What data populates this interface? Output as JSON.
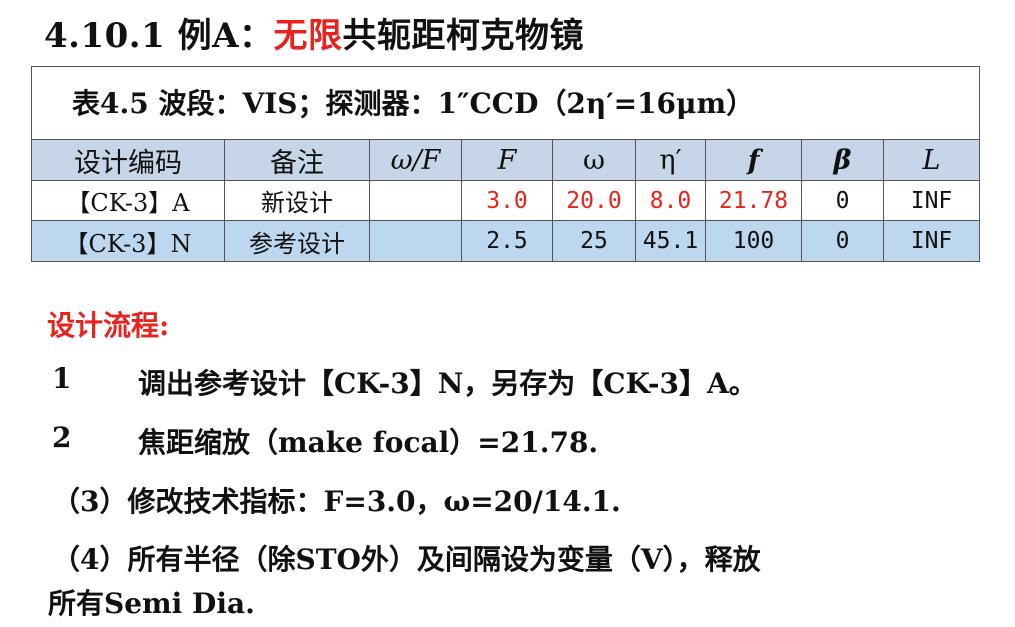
{
  "title": {
    "prefix": "4.10.1  例A：",
    "highlight": "无限",
    "suffix": "共轭距柯克物镜"
  },
  "table": {
    "caption": "表4.5    波段：VIS；探测器：1″CCD（2η′=16μm）",
    "headers": [
      "设计编码",
      "备注",
      "ω/F",
      "F",
      "ω",
      "η′",
      "f",
      "β",
      "L"
    ],
    "rows": [
      {
        "code": "【CK-3】A",
        "note": "新设计",
        "omega_f": "",
        "F": "3.0",
        "omega": "20.0",
        "eta": "8.0",
        "f": "21.78",
        "beta": "0",
        "L": "INF"
      },
      {
        "code": "【CK-3】N",
        "note": "参考设计",
        "omega_f": "",
        "F": "2.5",
        "omega": "25",
        "eta": "45.1",
        "f": "100",
        "beta": "0",
        "L": "INF"
      }
    ]
  },
  "section_title": "设计流程:",
  "steps": [
    {
      "num": "1",
      "text": "调出参考设计【CK-3】N，另存为【CK-3】A。"
    },
    {
      "num": "2",
      "text": "焦距缩放（make focal）=21.78."
    },
    {
      "num": "",
      "text": "（3）修改技术指标：F=3.0，ω=20/14.1."
    },
    {
      "num": "",
      "text": "（4）所有半径（除STO外）及间隔设为变量（V），释放"
    },
    {
      "num": "",
      "text": "所有Semi Dia."
    }
  ],
  "colors": {
    "accent_red": "#e8231e",
    "header_bg": "#c6d6e8",
    "highlight_row_bg": "#bdd7ee"
  }
}
